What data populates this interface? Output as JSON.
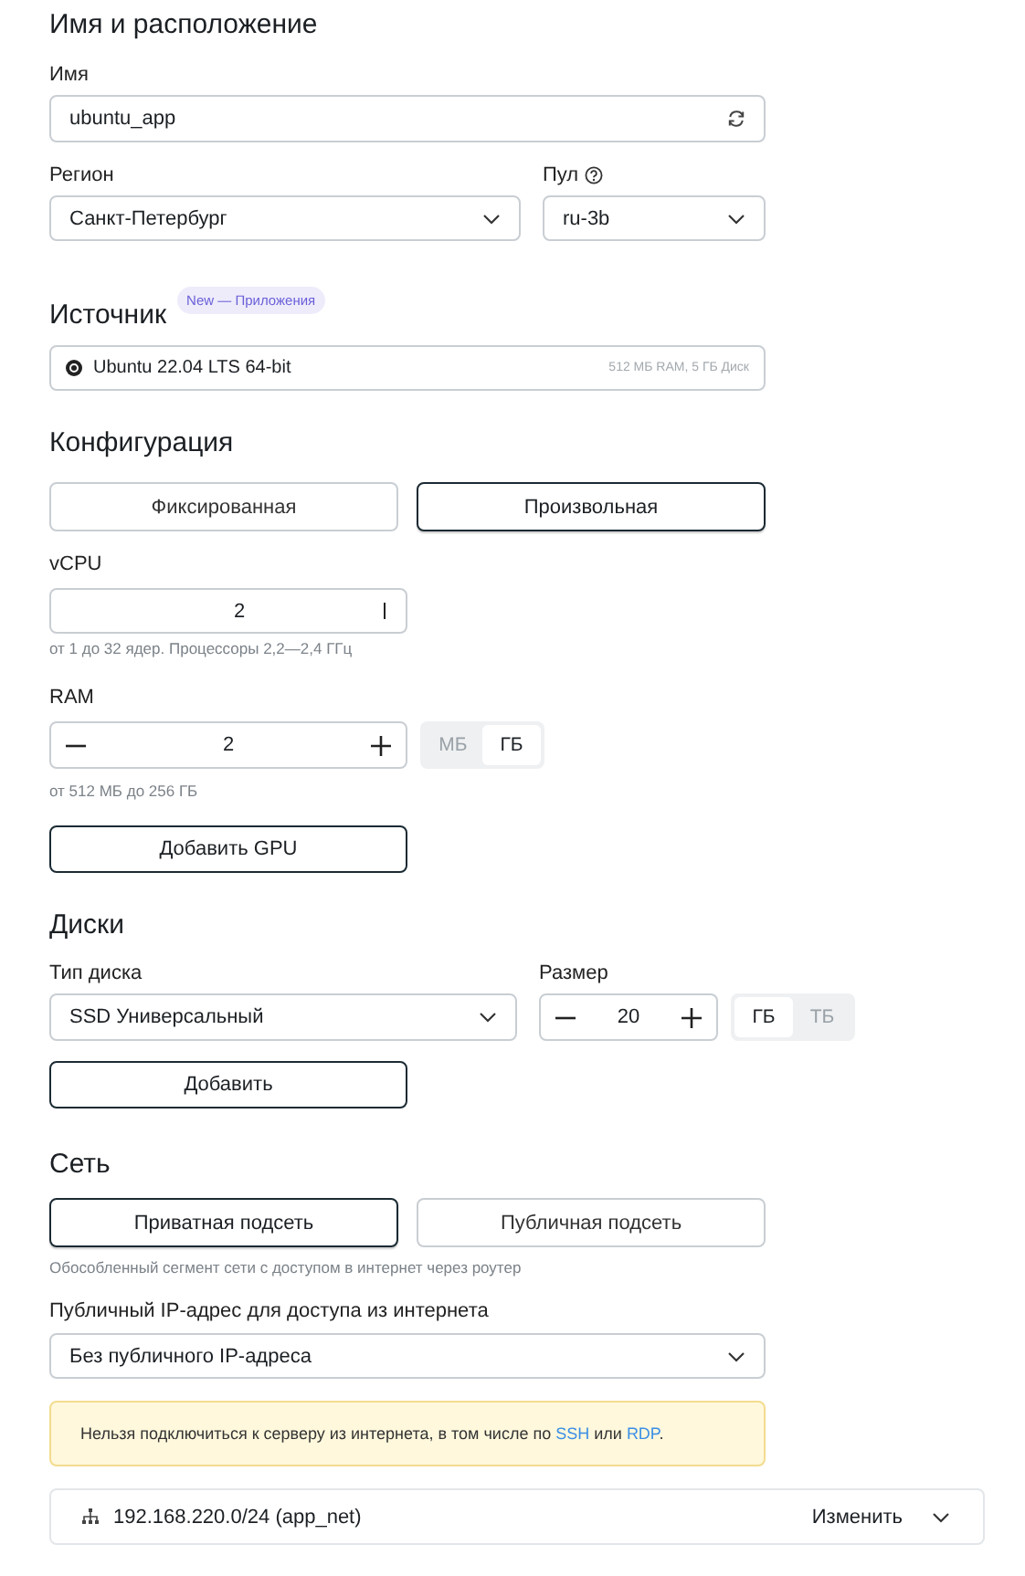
{
  "name_location": {
    "title": "Имя и расположение",
    "name_label": "Имя",
    "name_value": "ubuntu_app",
    "region_label": "Регион",
    "region_value": "Санкт-Петербург",
    "pool_label": "Пул",
    "pool_value": "ru-3b"
  },
  "source": {
    "title": "Источник",
    "badge": "New — Приложения",
    "image": "Ubuntu 22.04 LTS 64-bit",
    "image_specs": "512 МБ RAM, 5 ГБ Диск"
  },
  "configuration": {
    "title": "Конфигурация",
    "modes": [
      {
        "label": "Фиксированная",
        "selected": false
      },
      {
        "label": "Произвольная",
        "selected": true
      }
    ],
    "vcpu": {
      "label": "vCPU",
      "value": "2",
      "hint": "от 1 до 32 ядер. Процессоры 2,2—2,4 ГГц"
    },
    "ram": {
      "label": "RAM",
      "value": "2",
      "units": [
        {
          "label": "МБ",
          "selected": false
        },
        {
          "label": "ГБ",
          "selected": true
        }
      ],
      "hint": "от 512 МБ до 256 ГБ"
    },
    "gpu_button": "Добавить GPU"
  },
  "disks": {
    "title": "Диски",
    "type_label": "Тип диска",
    "type_value": "SSD Универсальный",
    "size_label": "Размер",
    "size_value": "20",
    "units": [
      {
        "label": "ГБ",
        "selected": true
      },
      {
        "label": "ТБ",
        "selected": false
      }
    ],
    "add_button": "Добавить"
  },
  "network": {
    "title": "Сеть",
    "modes": [
      {
        "label": "Приватная подсеть",
        "selected": true
      },
      {
        "label": "Публичная подсеть",
        "selected": false
      }
    ],
    "hint": "Обособленный сегмент сети с доступом в интернет через роутер",
    "ip_label": "Публичный IP-адрес для доступа из интернета",
    "ip_value": "Без публичного IP-адреса",
    "notice": [
      {
        "kind": "text",
        "text": "Нельзя подключиться к серверу из интернета, в том числе по "
      },
      {
        "kind": "link",
        "text": "SSH"
      },
      {
        "kind": "text",
        "text": " или "
      },
      {
        "kind": "link",
        "text": "RDP"
      },
      {
        "kind": "text",
        "text": "."
      }
    ],
    "subnet": "192.168.220.0/24 (app_net)",
    "change_button": "Изменить"
  }
}
